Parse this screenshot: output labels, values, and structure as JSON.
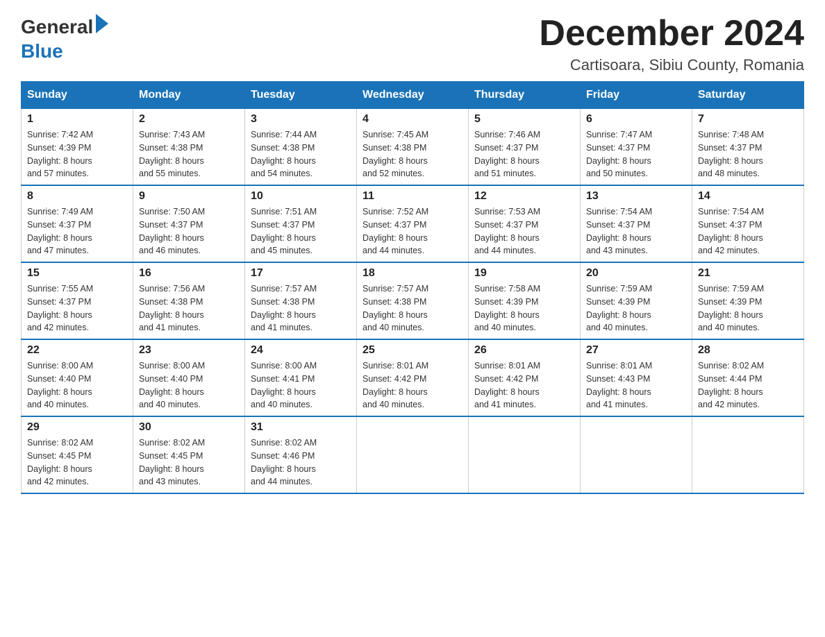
{
  "header": {
    "logo_general": "General",
    "logo_blue": "Blue",
    "main_title": "December 2024",
    "subtitle": "Cartisoara, Sibiu County, Romania"
  },
  "days_of_week": [
    "Sunday",
    "Monday",
    "Tuesday",
    "Wednesday",
    "Thursday",
    "Friday",
    "Saturday"
  ],
  "weeks": [
    [
      {
        "day": "1",
        "sunrise": "7:42 AM",
        "sunset": "4:39 PM",
        "daylight": "8 hours and 57 minutes."
      },
      {
        "day": "2",
        "sunrise": "7:43 AM",
        "sunset": "4:38 PM",
        "daylight": "8 hours and 55 minutes."
      },
      {
        "day": "3",
        "sunrise": "7:44 AM",
        "sunset": "4:38 PM",
        "daylight": "8 hours and 54 minutes."
      },
      {
        "day": "4",
        "sunrise": "7:45 AM",
        "sunset": "4:38 PM",
        "daylight": "8 hours and 52 minutes."
      },
      {
        "day": "5",
        "sunrise": "7:46 AM",
        "sunset": "4:37 PM",
        "daylight": "8 hours and 51 minutes."
      },
      {
        "day": "6",
        "sunrise": "7:47 AM",
        "sunset": "4:37 PM",
        "daylight": "8 hours and 50 minutes."
      },
      {
        "day": "7",
        "sunrise": "7:48 AM",
        "sunset": "4:37 PM",
        "daylight": "8 hours and 48 minutes."
      }
    ],
    [
      {
        "day": "8",
        "sunrise": "7:49 AM",
        "sunset": "4:37 PM",
        "daylight": "8 hours and 47 minutes."
      },
      {
        "day": "9",
        "sunrise": "7:50 AM",
        "sunset": "4:37 PM",
        "daylight": "8 hours and 46 minutes."
      },
      {
        "day": "10",
        "sunrise": "7:51 AM",
        "sunset": "4:37 PM",
        "daylight": "8 hours and 45 minutes."
      },
      {
        "day": "11",
        "sunrise": "7:52 AM",
        "sunset": "4:37 PM",
        "daylight": "8 hours and 44 minutes."
      },
      {
        "day": "12",
        "sunrise": "7:53 AM",
        "sunset": "4:37 PM",
        "daylight": "8 hours and 44 minutes."
      },
      {
        "day": "13",
        "sunrise": "7:54 AM",
        "sunset": "4:37 PM",
        "daylight": "8 hours and 43 minutes."
      },
      {
        "day": "14",
        "sunrise": "7:54 AM",
        "sunset": "4:37 PM",
        "daylight": "8 hours and 42 minutes."
      }
    ],
    [
      {
        "day": "15",
        "sunrise": "7:55 AM",
        "sunset": "4:37 PM",
        "daylight": "8 hours and 42 minutes."
      },
      {
        "day": "16",
        "sunrise": "7:56 AM",
        "sunset": "4:38 PM",
        "daylight": "8 hours and 41 minutes."
      },
      {
        "day": "17",
        "sunrise": "7:57 AM",
        "sunset": "4:38 PM",
        "daylight": "8 hours and 41 minutes."
      },
      {
        "day": "18",
        "sunrise": "7:57 AM",
        "sunset": "4:38 PM",
        "daylight": "8 hours and 40 minutes."
      },
      {
        "day": "19",
        "sunrise": "7:58 AM",
        "sunset": "4:39 PM",
        "daylight": "8 hours and 40 minutes."
      },
      {
        "day": "20",
        "sunrise": "7:59 AM",
        "sunset": "4:39 PM",
        "daylight": "8 hours and 40 minutes."
      },
      {
        "day": "21",
        "sunrise": "7:59 AM",
        "sunset": "4:39 PM",
        "daylight": "8 hours and 40 minutes."
      }
    ],
    [
      {
        "day": "22",
        "sunrise": "8:00 AM",
        "sunset": "4:40 PM",
        "daylight": "8 hours and 40 minutes."
      },
      {
        "day": "23",
        "sunrise": "8:00 AM",
        "sunset": "4:40 PM",
        "daylight": "8 hours and 40 minutes."
      },
      {
        "day": "24",
        "sunrise": "8:00 AM",
        "sunset": "4:41 PM",
        "daylight": "8 hours and 40 minutes."
      },
      {
        "day": "25",
        "sunrise": "8:01 AM",
        "sunset": "4:42 PM",
        "daylight": "8 hours and 40 minutes."
      },
      {
        "day": "26",
        "sunrise": "8:01 AM",
        "sunset": "4:42 PM",
        "daylight": "8 hours and 41 minutes."
      },
      {
        "day": "27",
        "sunrise": "8:01 AM",
        "sunset": "4:43 PM",
        "daylight": "8 hours and 41 minutes."
      },
      {
        "day": "28",
        "sunrise": "8:02 AM",
        "sunset": "4:44 PM",
        "daylight": "8 hours and 42 minutes."
      }
    ],
    [
      {
        "day": "29",
        "sunrise": "8:02 AM",
        "sunset": "4:45 PM",
        "daylight": "8 hours and 42 minutes."
      },
      {
        "day": "30",
        "sunrise": "8:02 AM",
        "sunset": "4:45 PM",
        "daylight": "8 hours and 43 minutes."
      },
      {
        "day": "31",
        "sunrise": "8:02 AM",
        "sunset": "4:46 PM",
        "daylight": "8 hours and 44 minutes."
      },
      null,
      null,
      null,
      null
    ]
  ],
  "labels": {
    "sunrise": "Sunrise: ",
    "sunset": "Sunset: ",
    "daylight": "Daylight: "
  }
}
